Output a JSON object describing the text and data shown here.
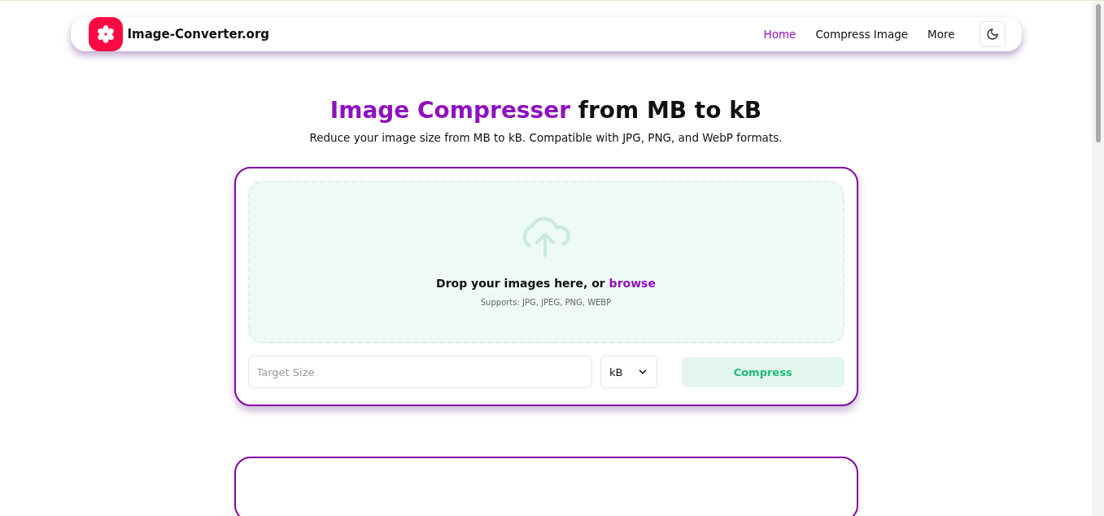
{
  "header": {
    "brand": "Image-Converter.org",
    "nav": [
      {
        "label": "Home",
        "selected": true
      },
      {
        "label": "Compress Image",
        "selected": false
      },
      {
        "label": "More",
        "selected": false
      }
    ]
  },
  "hero": {
    "title_highlight": "Image Compresser",
    "title_rest": "from MB to kB",
    "subtitle": "Reduce your image size from MB to kB. Compatible with JPG, PNG, and WebP formats."
  },
  "uploader": {
    "prompt": "Drop your images here, or",
    "link": "browse",
    "supports": "Supports: JPG, JPEG, PNG, WEBP"
  },
  "controls": {
    "placeholder": "Target Size",
    "unit": "kB",
    "button": "Compress"
  }
}
